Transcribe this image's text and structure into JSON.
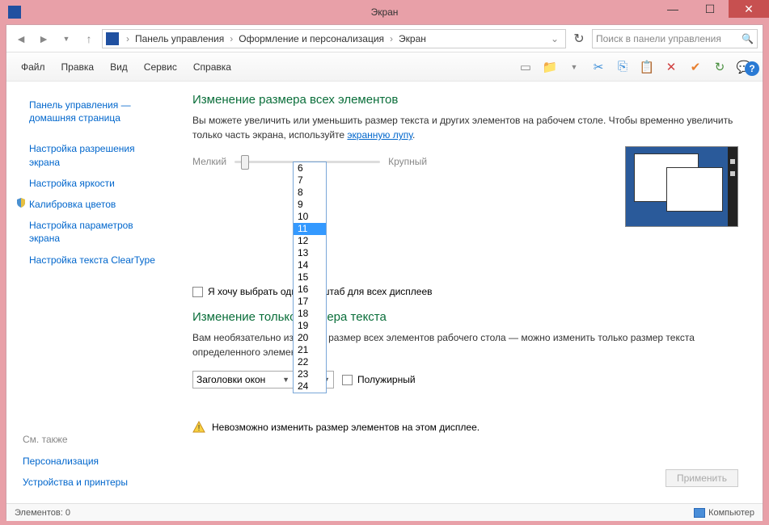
{
  "title": "Экран",
  "breadcrumb": {
    "item1": "Панель управления",
    "item2": "Оформление и персонализация",
    "item3": "Экран"
  },
  "search": {
    "placeholder": "Поиск в панели управления"
  },
  "menu": {
    "file": "Файл",
    "edit": "Правка",
    "view": "Вид",
    "service": "Сервис",
    "help": "Справка"
  },
  "sidebar": {
    "home": "Панель управления — домашняя страница",
    "resolution": "Настройка разрешения экрана",
    "brightness": "Настройка яркости",
    "calibration": "Калибровка цветов",
    "params": "Настройка параметров экрана",
    "cleartype": "Настройка текста ClearType",
    "seealso": "См. также",
    "personalization": "Персонализация",
    "devices": "Устройства и принтеры"
  },
  "main": {
    "heading1": "Изменение размера всех элементов",
    "para1_a": "Вы можете увеличить или уменьшить размер текста и других элементов на рабочем столе. Чтобы временно увеличить только часть экрана, используйте ",
    "para1_link": "экранную лупу",
    "para1_b": ".",
    "slider_small": "Мелкий",
    "slider_large": "Крупный",
    "checkbox_label": "Я хочу выбрать один масштаб для всех дисплеев",
    "heading2": "Изменение только размера текста",
    "para2": "Вам необязательно изменять размер всех элементов рабочего стола — можно изменить только размер текста определенного элемента.",
    "combo_element": "Заголовки окон",
    "combo_size": "11",
    "bold_label": "Полужирный",
    "warning": "Невозможно изменить размер элементов на этом дисплее.",
    "apply": "Применить"
  },
  "dropdown": {
    "options": [
      "6",
      "7",
      "8",
      "9",
      "10",
      "11",
      "12",
      "13",
      "14",
      "15",
      "16",
      "17",
      "18",
      "19",
      "20",
      "21",
      "22",
      "23",
      "24"
    ],
    "selected": "11"
  },
  "statusbar": {
    "left": "Элементов: 0",
    "right": "Компьютер"
  }
}
